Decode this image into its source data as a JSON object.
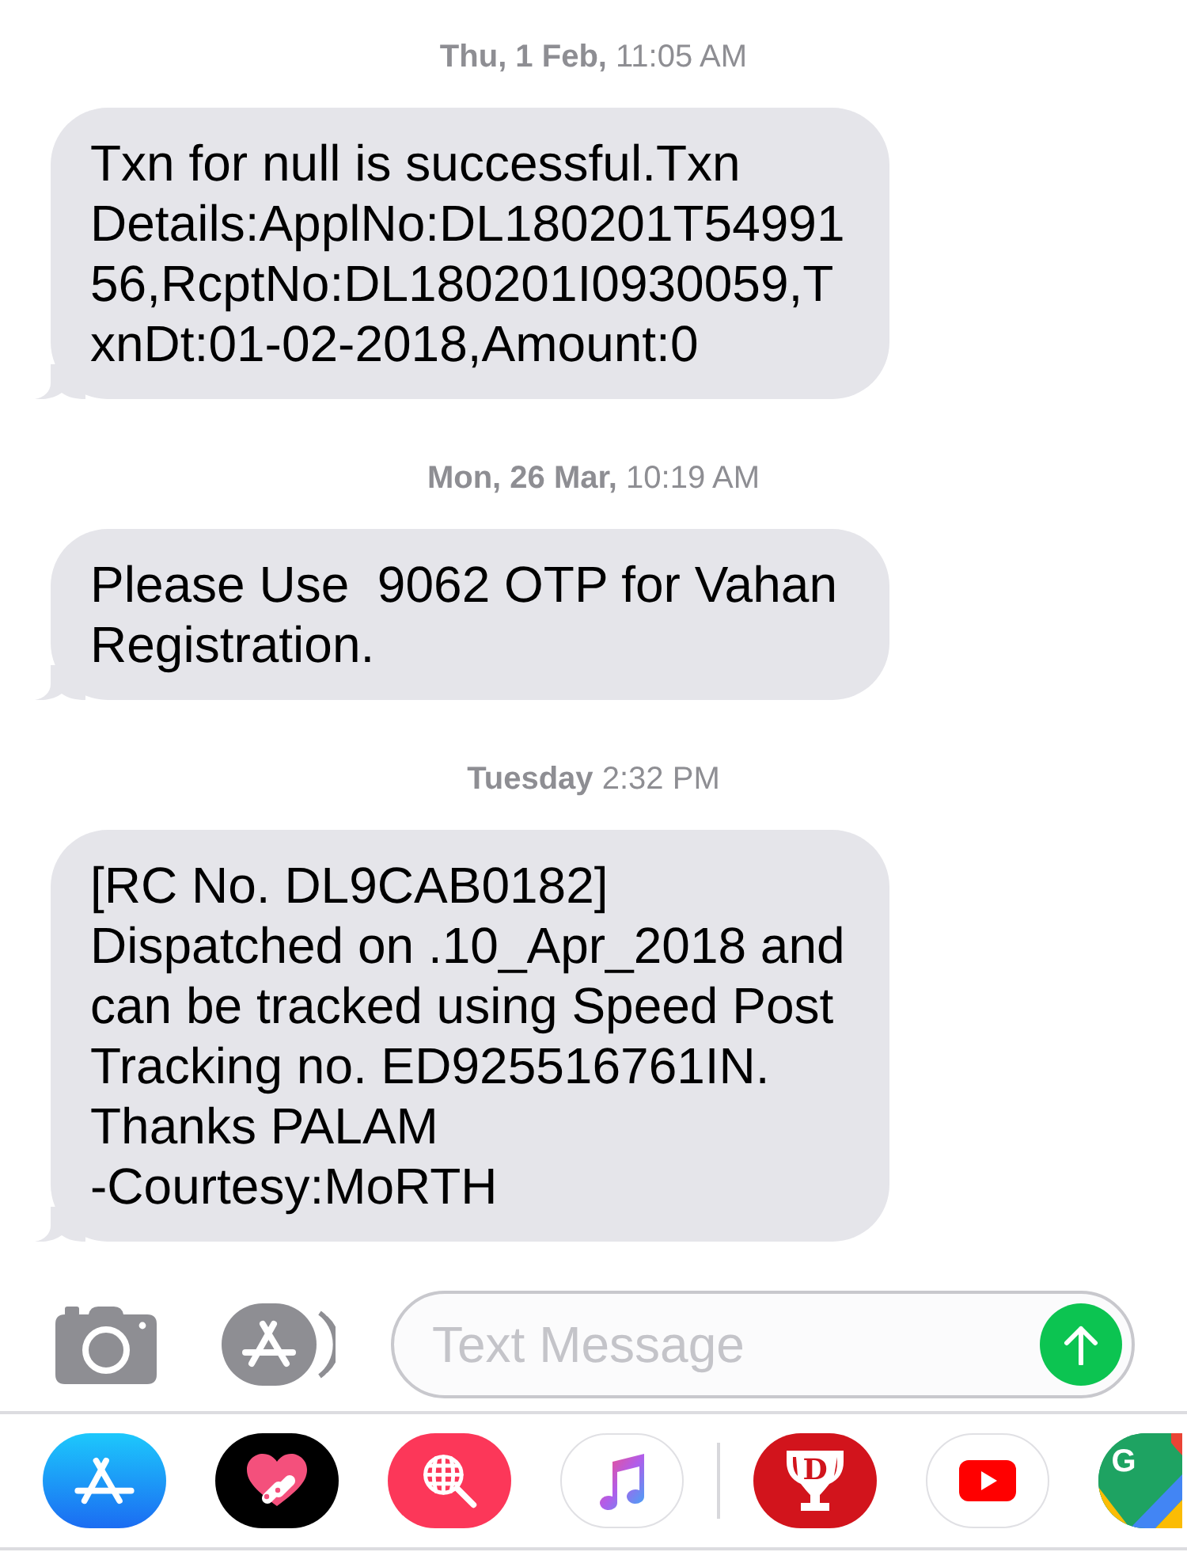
{
  "messages": [
    {
      "timestamp": "**Thu, 1 Feb,** 11:05 AM",
      "text": "Txn for null is successful.Txn\nDetails:ApplNo:DL180201T54991\n56,RcptNo:DL180201I0930059,T\nxnDt:01-02-2018,Amount:0"
    },
    {
      "timestamp": "**Mon, 26 Mar,** 10:19 AM",
      "text": "Please Use  9062 OTP for Vahan\nRegistration."
    },
    {
      "timestamp": "**Tuesday** 2:32 PM",
      "text": "[RC No. DL9CAB0182]\nDispatched on .10_Apr_2018 and\ncan be tracked using Speed Post\nTracking no. ED925516761IN.\nThanks PALAM\n-Courtesy:MoRTH"
    }
  ],
  "composer": {
    "placeholder": "Text Message"
  },
  "app_drawer": [
    {
      "kind": "store"
    },
    {
      "kind": "touch"
    },
    {
      "kind": "images"
    },
    {
      "kind": "music"
    },
    {
      "kind": "separator"
    },
    {
      "kind": "trophy",
      "letter": "D"
    },
    {
      "kind": "video"
    },
    {
      "kind": "map",
      "letter": "G"
    }
  ]
}
